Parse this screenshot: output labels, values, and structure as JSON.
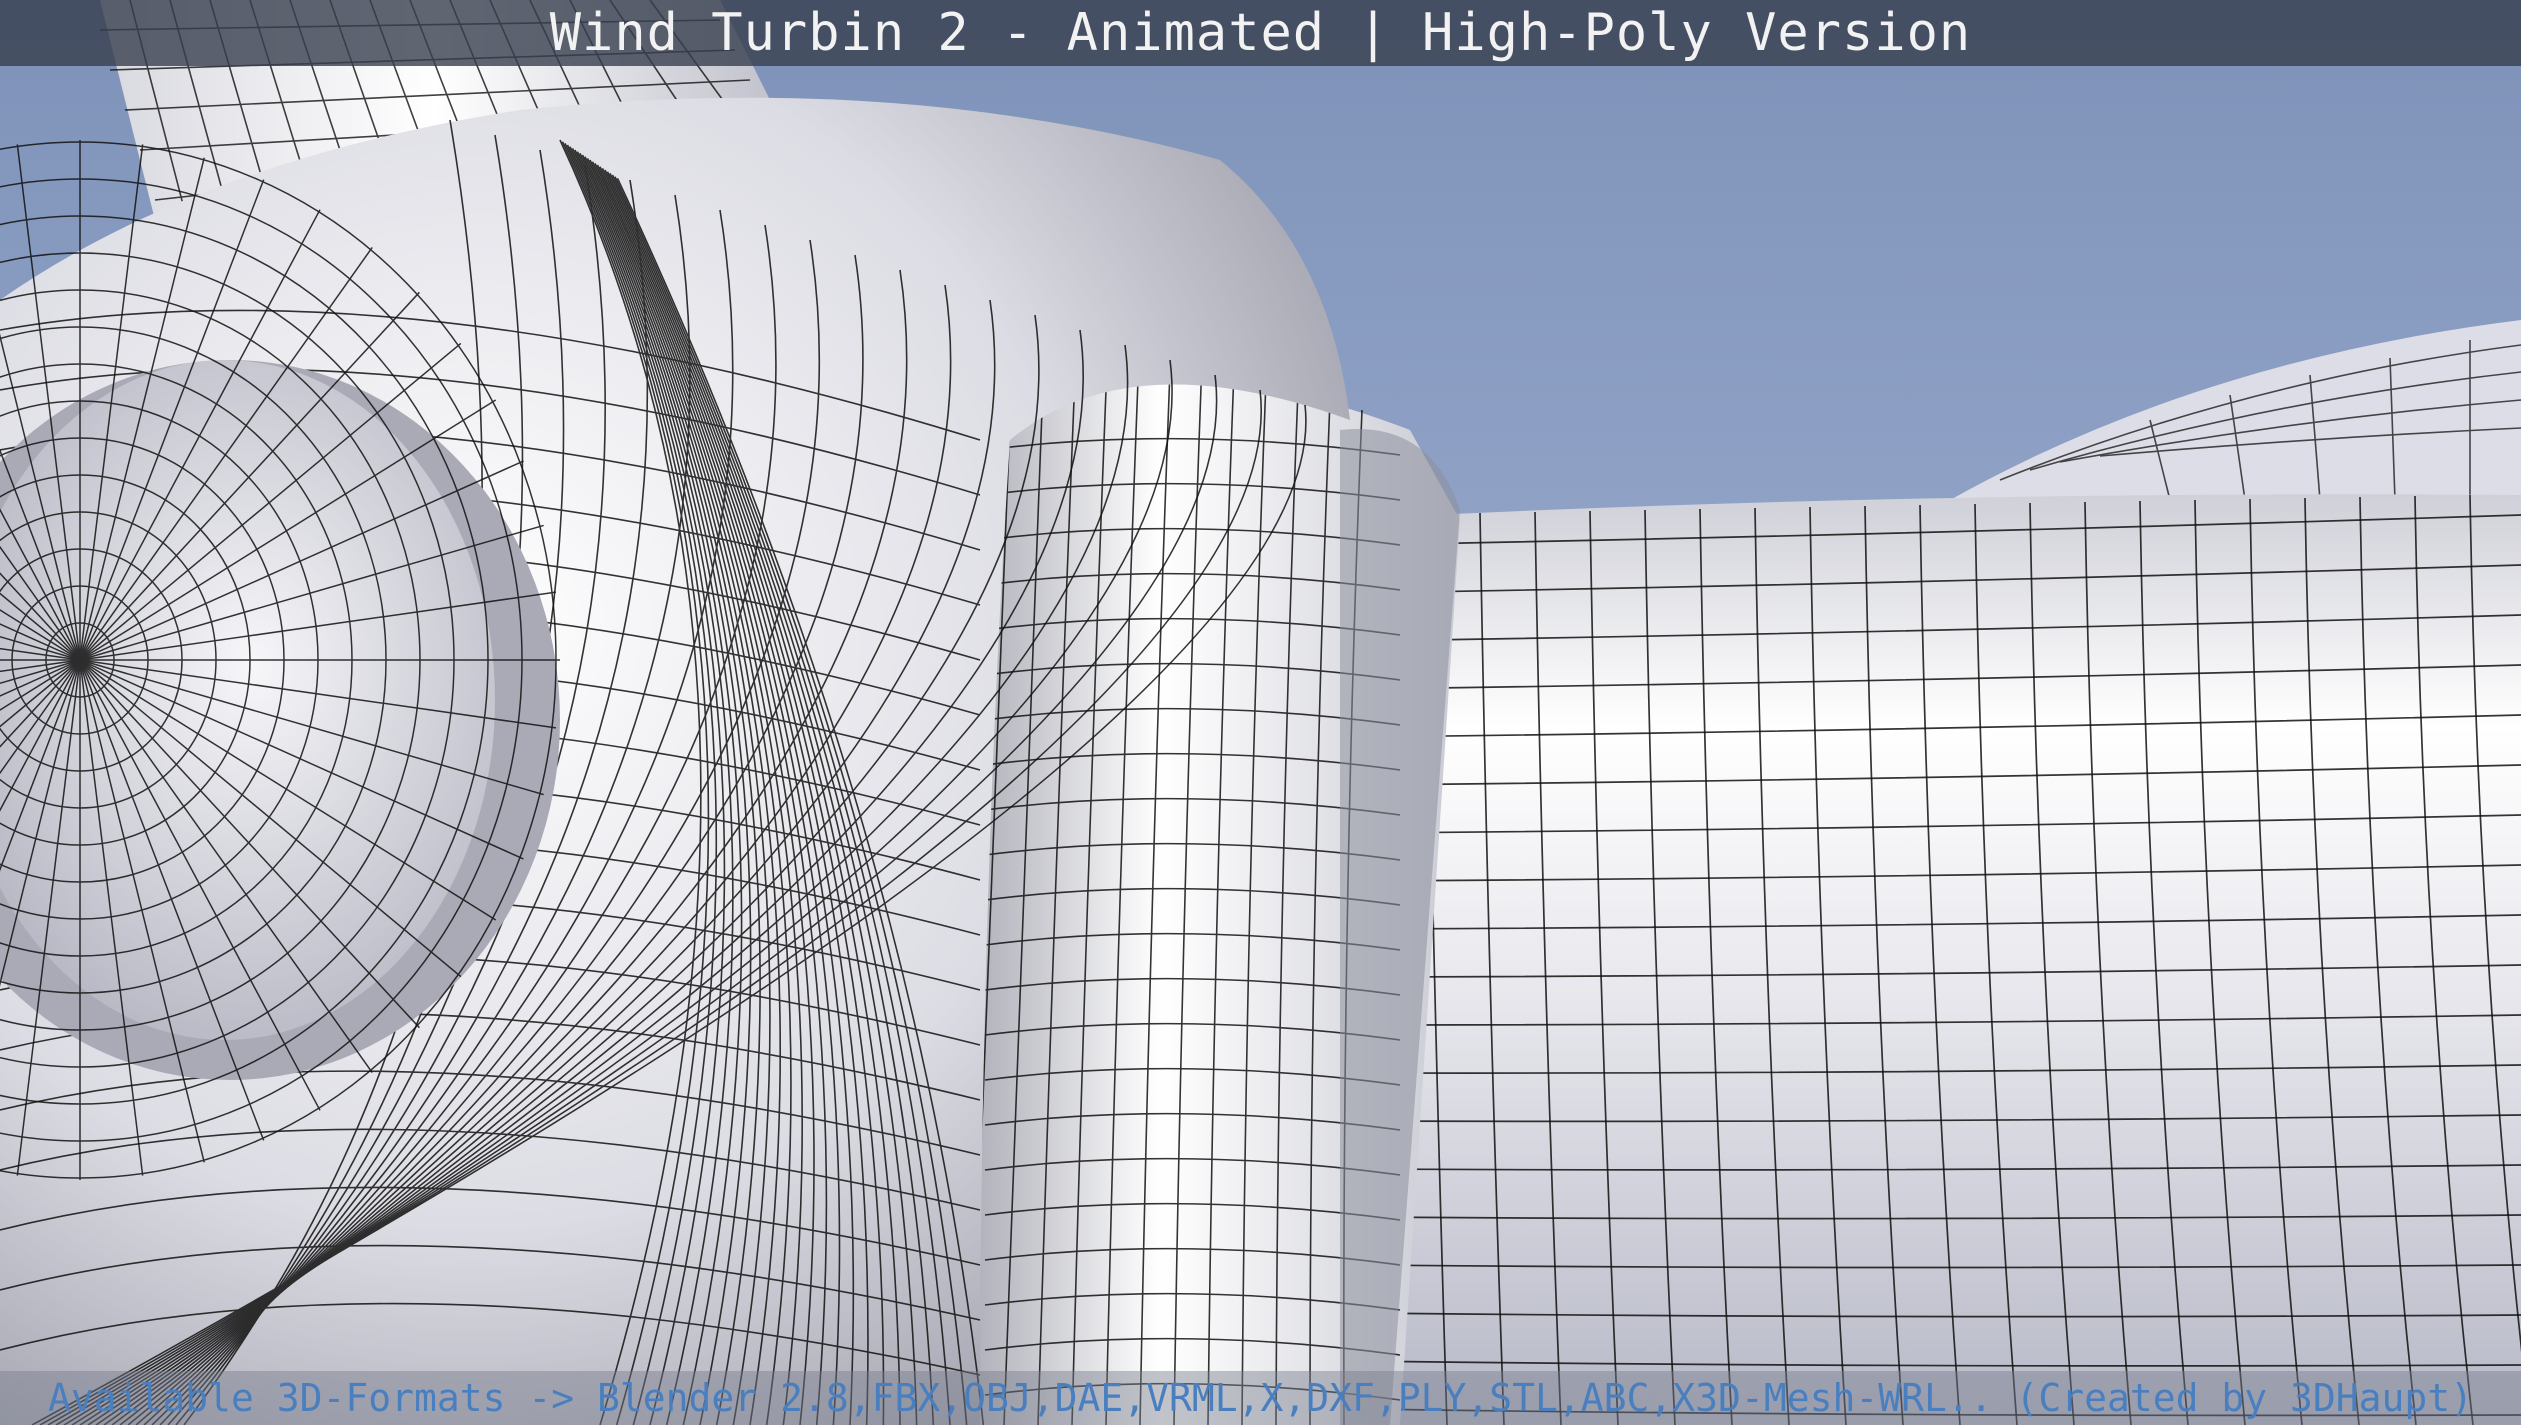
{
  "window": {
    "title": "Wind Turbin 2 - Animated | High-Poly Version"
  },
  "footer": {
    "text": "Available 3D-Formats -> Blender 2.8,FBX,OBJ,DAE,VRML,X,DXF,PLY,STL,ABC,X3D-Mesh-WRL.. (Created by 3DHaupt)"
  },
  "colors": {
    "sky_top": "#7f93bb",
    "sky_bottom": "#a9b8d8",
    "mesh_light": "#ffffff",
    "mesh_shadow": "#8e8e98",
    "wire": "#111111",
    "footer_text": "#4a7fbf"
  }
}
